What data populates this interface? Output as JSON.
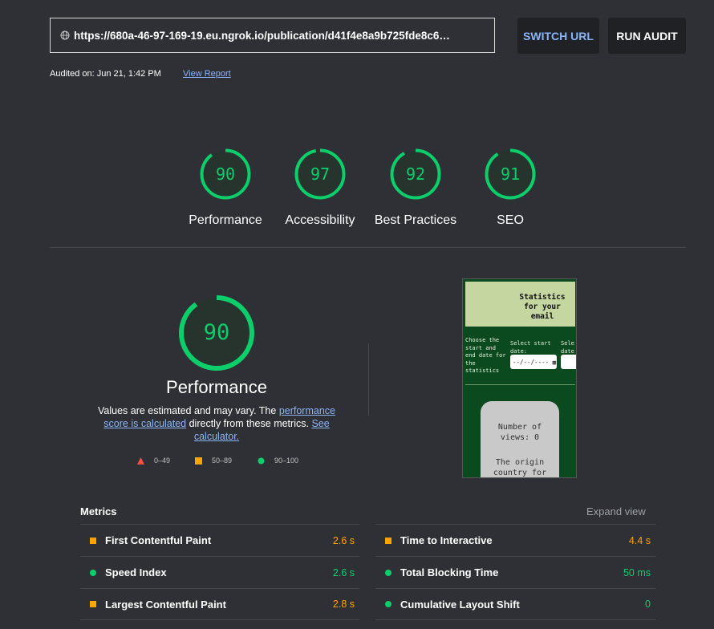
{
  "header": {
    "url": "https://680a-46-97-169-19.eu.ngrok.io/publication/d41f4e8a9b725fde8c6…",
    "switch_url_label": "SWITCH URL",
    "run_audit_label": "RUN AUDIT",
    "audited_on": "Audited on: Jun 21, 1:42 PM",
    "view_report": "View Report"
  },
  "scores": [
    {
      "label": "Performance",
      "score": "90",
      "value": 90
    },
    {
      "label": "Accessibility",
      "score": "97",
      "value": 97
    },
    {
      "label": "Best Practices",
      "score": "92",
      "value": 92
    },
    {
      "label": "SEO",
      "score": "91",
      "value": 91
    }
  ],
  "performance": {
    "score": "90",
    "value": 90,
    "title": "Performance",
    "desc_prefix": "Values are estimated and may vary. The ",
    "desc_link1": "performance score is calculated",
    "desc_middle": " directly from these metrics.",
    "desc_link2": "See calculator."
  },
  "legend": [
    {
      "range": "0–49",
      "color": "#ff4e42",
      "shape": "triangle"
    },
    {
      "range": "50–89",
      "color": "#ffa400",
      "shape": "square"
    },
    {
      "range": "90–100",
      "color": "#0cce6b",
      "shape": "circle"
    }
  ],
  "screenshot": {
    "title_line1": "Statistics",
    "title_line2": "for your",
    "title_line3": "email",
    "field1": "Choose the start and end date for the statistics",
    "field2": "Select start date:",
    "field3": "Sele date",
    "date_placeholder": "--/--/---- ▦",
    "card_line1": "Number of",
    "card_line2": "views: 0",
    "card_line3": "The origin",
    "card_line4": "country for"
  },
  "metrics": {
    "title": "Metrics",
    "expand": "Expand view",
    "left": [
      {
        "name": "First Contentful Paint",
        "value": "2.6 s",
        "status": "average"
      },
      {
        "name": "Speed Index",
        "value": "2.6 s",
        "status": "pass"
      },
      {
        "name": "Largest Contentful Paint",
        "value": "2.8 s",
        "status": "average"
      }
    ],
    "right": [
      {
        "name": "Time to Interactive",
        "value": "4.4 s",
        "status": "average"
      },
      {
        "name": "Total Blocking Time",
        "value": "50 ms",
        "status": "pass"
      },
      {
        "name": "Cumulative Layout Shift",
        "value": "0",
        "status": "pass"
      }
    ]
  },
  "colors": {
    "pass": "#0cce6b",
    "average": "#ffa400",
    "fail": "#ff4e42",
    "background": "#2f3035",
    "link": "#8ab4f8"
  }
}
